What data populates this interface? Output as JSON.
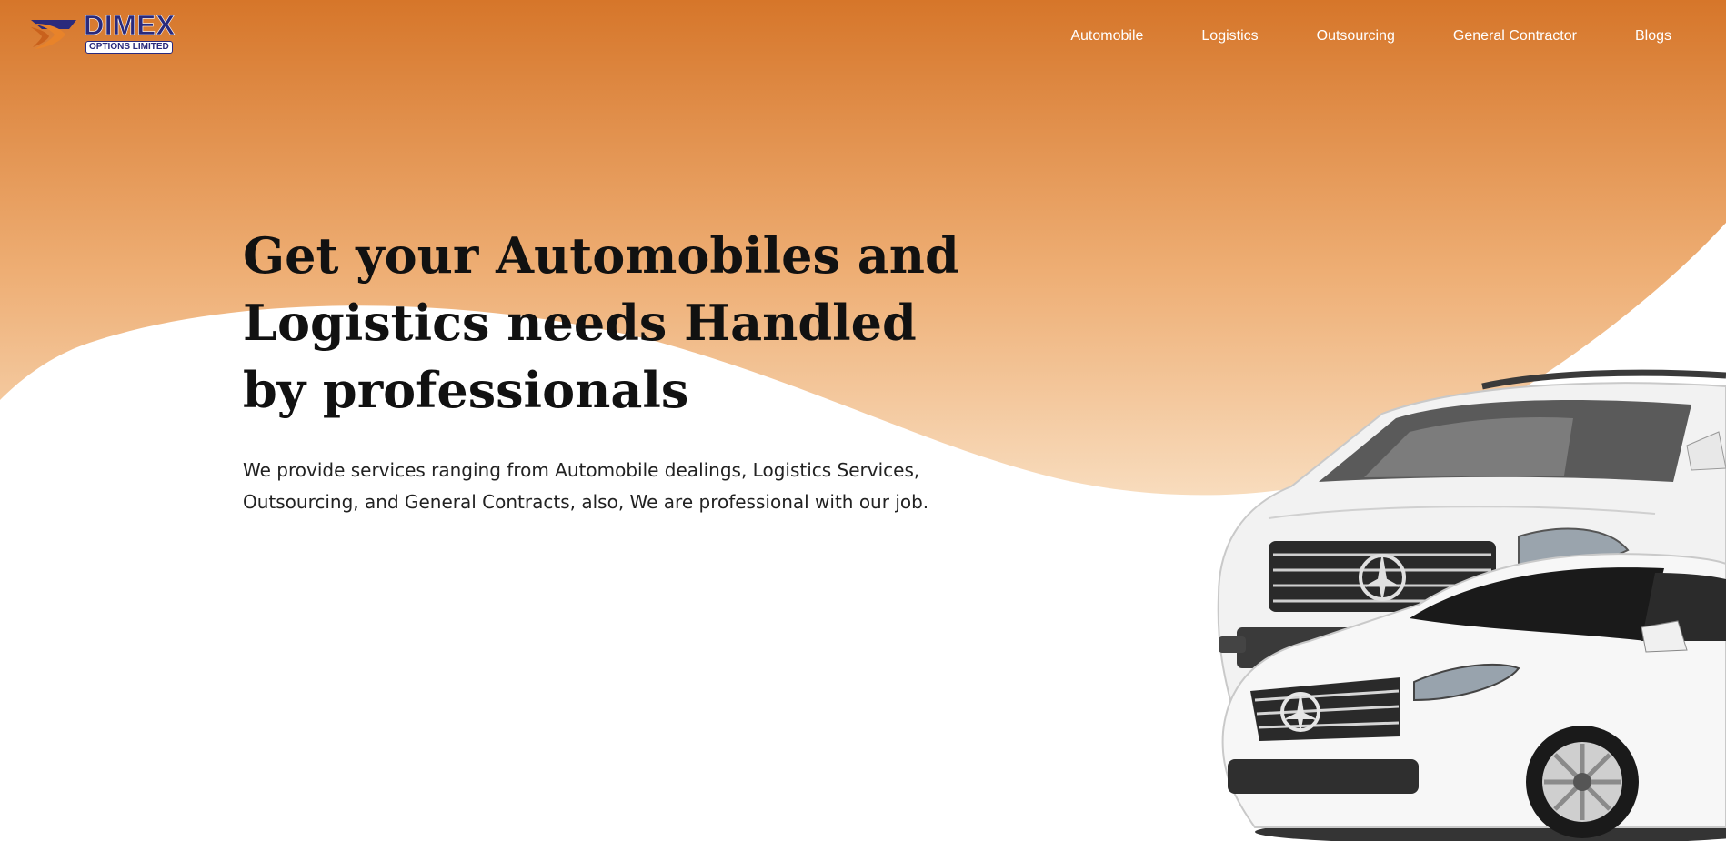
{
  "brand": {
    "name": "DIMEX",
    "tagline": "OPTIONS LIMITED",
    "logo_icon": "dimex-swoosh-logo",
    "colors": {
      "navy": "#2a2a7c",
      "orange": "#e8832a"
    }
  },
  "nav": {
    "items": [
      {
        "label": "Automobile"
      },
      {
        "label": "Logistics"
      },
      {
        "label": "Outsourcing"
      },
      {
        "label": "General Contractor"
      },
      {
        "label": "Blogs"
      }
    ]
  },
  "hero": {
    "title": "Get your Automobiles and Logistics needs Handled by professionals",
    "description": "We provide services ranging from Automobile dealings, Logistics Services, Outsourcing, and General Contracts, also, We are professional with our job.",
    "image": "white-mercedes-cars-image"
  },
  "theme": {
    "gradient_top": "#d8782a",
    "gradient_bottom": "#f6d4b0",
    "background": "#ffffff",
    "text": "#111111"
  }
}
